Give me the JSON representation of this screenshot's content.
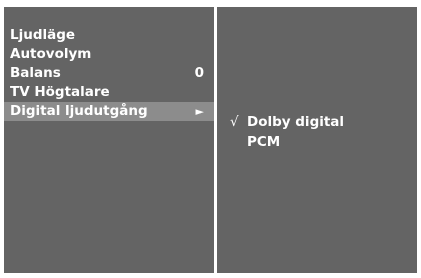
{
  "menu": {
    "items": [
      {
        "label": "Ljudläge",
        "value": "",
        "selected": false
      },
      {
        "label": "Autovolym",
        "value": "",
        "selected": false
      },
      {
        "label": "Balans",
        "value": "0",
        "selected": false
      },
      {
        "label": "TV Högtalare",
        "value": "",
        "selected": false
      },
      {
        "label": "Digital ljudutgång",
        "value": "",
        "selected": true,
        "arrow": "►"
      }
    ]
  },
  "submenu": {
    "check_mark": "√",
    "options": [
      {
        "label": "Dolby digital",
        "checked": true
      },
      {
        "label": "PCM",
        "checked": false
      }
    ]
  },
  "colors": {
    "panel": "#646464",
    "highlight": "#8c8c8c",
    "text": "#ffffff",
    "divider": "#ffffff"
  }
}
